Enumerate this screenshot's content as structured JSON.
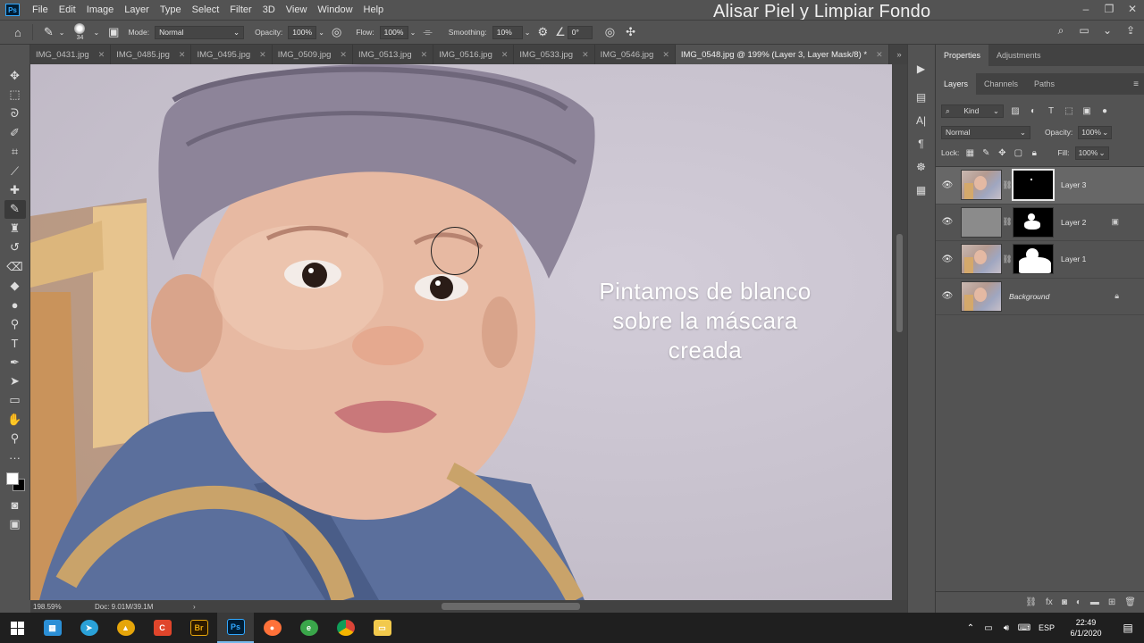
{
  "window": {
    "overlay_title": "Alisar Piel y Limpiar Fondo",
    "controls": [
      "–",
      "❐",
      "✕"
    ]
  },
  "menu": [
    "File",
    "Edit",
    "Image",
    "Layer",
    "Type",
    "Select",
    "Filter",
    "3D",
    "View",
    "Window",
    "Help"
  ],
  "options": {
    "brush_size": "34",
    "mode_label": "Mode:",
    "mode_value": "Normal",
    "opacity_label": "Opacity:",
    "opacity_value": "100%",
    "flow_label": "Flow:",
    "flow_value": "100%",
    "smoothing_label": "Smoothing:",
    "smoothing_value": "10%",
    "angle_value": "0°"
  },
  "tabs": [
    {
      "label": "IMG_0431.jpg"
    },
    {
      "label": "IMG_0485.jpg"
    },
    {
      "label": "IMG_0495.jpg"
    },
    {
      "label": "IMG_0509.jpg"
    },
    {
      "label": "IMG_0513.jpg"
    },
    {
      "label": "IMG_0516.jpg"
    },
    {
      "label": "IMG_0533.jpg"
    },
    {
      "label": "IMG_0546.jpg"
    },
    {
      "label": "IMG_0548.jpg @ 199% (Layer 3, Layer Mask/8) *"
    }
  ],
  "tools": [
    "move-icon",
    "marquee-icon",
    "lasso-icon",
    "quick-select-icon",
    "crop-icon",
    "eyedropper-icon",
    "healing-icon",
    "brush-icon",
    "stamp-icon",
    "history-brush-icon",
    "eraser-icon",
    "bucket-icon",
    "blur-icon",
    "dodge-icon",
    "type-icon",
    "pen-icon",
    "path-select-icon",
    "rectangle-icon",
    "hand-icon",
    "zoom-icon",
    "more-icon"
  ],
  "canvas": {
    "overlay_text_line1": "Pintamos de blanco",
    "overlay_text_line2": "sobre la máscara",
    "overlay_text_line3": "creada"
  },
  "status": {
    "zoom": "198.59%",
    "doc": "Doc: 9.01M/39.1M",
    "arrow": "›"
  },
  "properties_panel": {
    "tabs": [
      "Properties",
      "Adjustments"
    ]
  },
  "layers_panel": {
    "tabs": [
      "Layers",
      "Channels",
      "Paths"
    ],
    "filter_kind": "Kind",
    "blend_mode": "Normal",
    "opacity_label": "Opacity:",
    "opacity_value": "100%",
    "lock_label": "Lock:",
    "fill_label": "Fill:",
    "fill_value": "100%",
    "layers": [
      {
        "name": "Layer 3",
        "selected": true
      },
      {
        "name": "Layer 2",
        "selected": false
      },
      {
        "name": "Layer 1",
        "selected": false
      },
      {
        "name": "Background",
        "selected": false
      }
    ]
  },
  "taskbar": {
    "language": "ESP",
    "time": "22:49",
    "date": "6/1/2020",
    "apps": [
      "files-icon",
      "telegram-icon",
      "vlc-icon",
      "app-red-icon",
      "bridge-icon",
      "photoshop-icon",
      "firefox-icon",
      "edge-icon",
      "chrome-icon",
      "explorer-icon"
    ]
  }
}
